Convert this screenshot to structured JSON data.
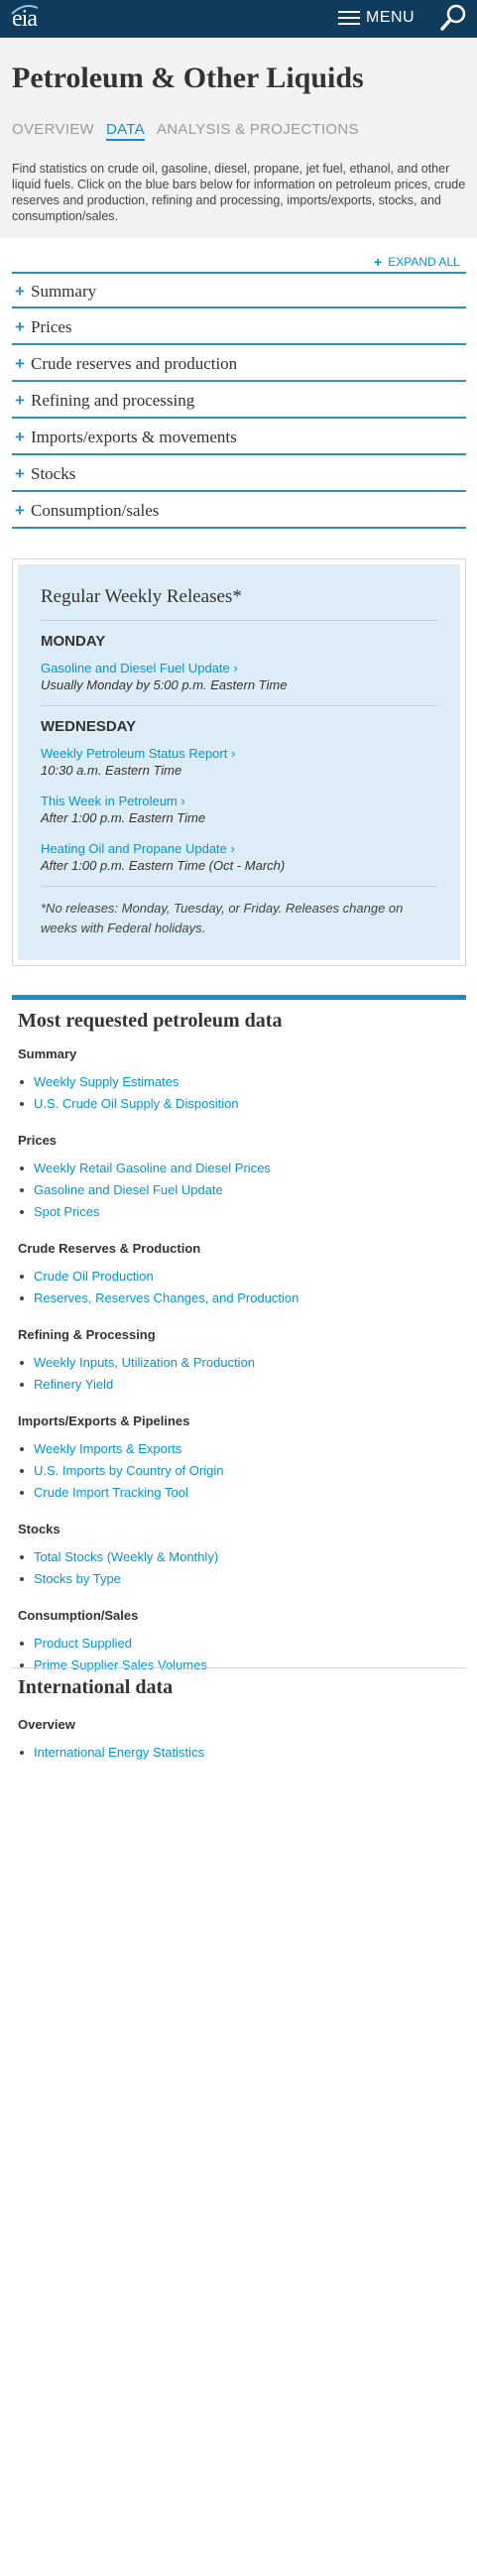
{
  "header": {
    "logo": "eia",
    "menu_label": "MENU"
  },
  "page": {
    "title": "Petroleum & Other Liquids",
    "tabs": [
      "OVERVIEW",
      "DATA",
      "ANALYSIS & PROJECTIONS"
    ],
    "active_tab": "DATA",
    "intro": "Find statistics on crude oil, gasoline, diesel, propane, jet fuel, ethanol, and other liquid fuels. Click on the blue bars below for information on petroleum prices, crude reserves and production, refining and processing, imports/exports, stocks, and consumption/sales.",
    "expand_all": "EXPAND ALL"
  },
  "accordion": [
    "Summary",
    "Prices",
    "Crude reserves and production",
    "Refining and processing",
    "Imports/exports & movements",
    "Stocks",
    "Consumption/sales"
  ],
  "weekly": {
    "title": "Regular Weekly Releases*",
    "days": [
      {
        "day": "MONDAY",
        "releases": [
          {
            "link": "Gasoline and Diesel Fuel Update ›",
            "time": "Usually Monday by 5:00 p.m. Eastern Time"
          }
        ]
      },
      {
        "day": "WEDNESDAY",
        "releases": [
          {
            "link": "Weekly Petroleum Status Report ›",
            "time": "10:30 a.m. Eastern Time"
          },
          {
            "link": "This Week in Petroleum ›",
            "time": "After 1:00 p.m. Eastern Time"
          },
          {
            "link": "Heating Oil and Propane Update ›",
            "time": "After 1:00 p.m. Eastern Time (Oct - March)"
          }
        ]
      }
    ],
    "note": "*No releases: Monday, Tuesday, or Friday. Releases change on weeks with Federal holidays."
  },
  "most_requested": {
    "title": "Most requested petroleum data",
    "groups": [
      {
        "heading": "Summary",
        "links": [
          "Weekly Supply Estimates",
          "U.S. Crude Oil Supply & Disposition"
        ]
      },
      {
        "heading": "Prices",
        "links": [
          "Weekly Retail Gasoline and Diesel Prices",
          "Gasoline and Diesel Fuel Update",
          "Spot Prices"
        ]
      },
      {
        "heading": "Crude Reserves & Production",
        "links": [
          "Crude Oil Production",
          "Reserves, Reserves Changes, and Production"
        ]
      },
      {
        "heading": "Refining & Processing",
        "links": [
          "Weekly Inputs, Utilization & Production",
          "Refinery Yield"
        ]
      },
      {
        "heading": "Imports/Exports & Pipelines",
        "links": [
          "Weekly Imports & Exports",
          "U.S. Imports by Country of Origin",
          "Crude Import Tracking Tool"
        ]
      },
      {
        "heading": "Stocks",
        "links": [
          "Total Stocks (Weekly & Monthly)",
          "Stocks by Type"
        ]
      },
      {
        "heading": "Consumption/Sales",
        "links": [
          "Product Supplied",
          "Prime Supplier Sales Volumes"
        ]
      }
    ]
  },
  "international": {
    "title": "International data",
    "groups": [
      {
        "heading": "Overview",
        "links": [
          "International Energy Statistics"
        ]
      }
    ]
  }
}
